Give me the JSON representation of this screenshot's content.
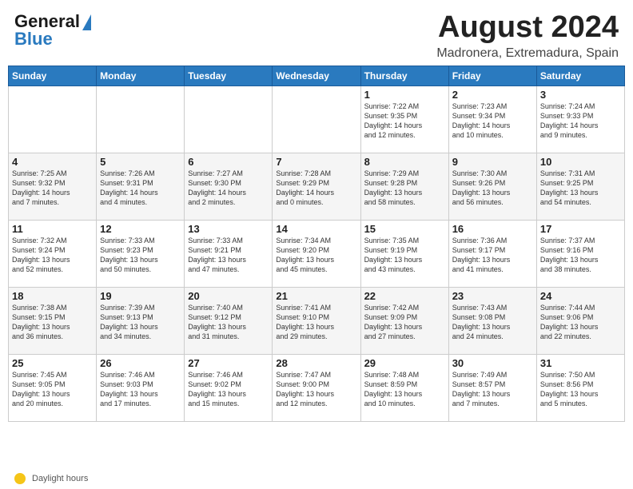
{
  "header": {
    "logo_line1": "General",
    "logo_line2": "Blue",
    "main_title": "August 2024",
    "subtitle": "Madronera, Extremadura, Spain"
  },
  "calendar": {
    "days_of_week": [
      "Sunday",
      "Monday",
      "Tuesday",
      "Wednesday",
      "Thursday",
      "Friday",
      "Saturday"
    ],
    "weeks": [
      [
        {
          "num": "",
          "info": ""
        },
        {
          "num": "",
          "info": ""
        },
        {
          "num": "",
          "info": ""
        },
        {
          "num": "",
          "info": ""
        },
        {
          "num": "1",
          "info": "Sunrise: 7:22 AM\nSunset: 9:35 PM\nDaylight: 14 hours\nand 12 minutes."
        },
        {
          "num": "2",
          "info": "Sunrise: 7:23 AM\nSunset: 9:34 PM\nDaylight: 14 hours\nand 10 minutes."
        },
        {
          "num": "3",
          "info": "Sunrise: 7:24 AM\nSunset: 9:33 PM\nDaylight: 14 hours\nand 9 minutes."
        }
      ],
      [
        {
          "num": "4",
          "info": "Sunrise: 7:25 AM\nSunset: 9:32 PM\nDaylight: 14 hours\nand 7 minutes."
        },
        {
          "num": "5",
          "info": "Sunrise: 7:26 AM\nSunset: 9:31 PM\nDaylight: 14 hours\nand 4 minutes."
        },
        {
          "num": "6",
          "info": "Sunrise: 7:27 AM\nSunset: 9:30 PM\nDaylight: 14 hours\nand 2 minutes."
        },
        {
          "num": "7",
          "info": "Sunrise: 7:28 AM\nSunset: 9:29 PM\nDaylight: 14 hours\nand 0 minutes."
        },
        {
          "num": "8",
          "info": "Sunrise: 7:29 AM\nSunset: 9:28 PM\nDaylight: 13 hours\nand 58 minutes."
        },
        {
          "num": "9",
          "info": "Sunrise: 7:30 AM\nSunset: 9:26 PM\nDaylight: 13 hours\nand 56 minutes."
        },
        {
          "num": "10",
          "info": "Sunrise: 7:31 AM\nSunset: 9:25 PM\nDaylight: 13 hours\nand 54 minutes."
        }
      ],
      [
        {
          "num": "11",
          "info": "Sunrise: 7:32 AM\nSunset: 9:24 PM\nDaylight: 13 hours\nand 52 minutes."
        },
        {
          "num": "12",
          "info": "Sunrise: 7:33 AM\nSunset: 9:23 PM\nDaylight: 13 hours\nand 50 minutes."
        },
        {
          "num": "13",
          "info": "Sunrise: 7:33 AM\nSunset: 9:21 PM\nDaylight: 13 hours\nand 47 minutes."
        },
        {
          "num": "14",
          "info": "Sunrise: 7:34 AM\nSunset: 9:20 PM\nDaylight: 13 hours\nand 45 minutes."
        },
        {
          "num": "15",
          "info": "Sunrise: 7:35 AM\nSunset: 9:19 PM\nDaylight: 13 hours\nand 43 minutes."
        },
        {
          "num": "16",
          "info": "Sunrise: 7:36 AM\nSunset: 9:17 PM\nDaylight: 13 hours\nand 41 minutes."
        },
        {
          "num": "17",
          "info": "Sunrise: 7:37 AM\nSunset: 9:16 PM\nDaylight: 13 hours\nand 38 minutes."
        }
      ],
      [
        {
          "num": "18",
          "info": "Sunrise: 7:38 AM\nSunset: 9:15 PM\nDaylight: 13 hours\nand 36 minutes."
        },
        {
          "num": "19",
          "info": "Sunrise: 7:39 AM\nSunset: 9:13 PM\nDaylight: 13 hours\nand 34 minutes."
        },
        {
          "num": "20",
          "info": "Sunrise: 7:40 AM\nSunset: 9:12 PM\nDaylight: 13 hours\nand 31 minutes."
        },
        {
          "num": "21",
          "info": "Sunrise: 7:41 AM\nSunset: 9:10 PM\nDaylight: 13 hours\nand 29 minutes."
        },
        {
          "num": "22",
          "info": "Sunrise: 7:42 AM\nSunset: 9:09 PM\nDaylight: 13 hours\nand 27 minutes."
        },
        {
          "num": "23",
          "info": "Sunrise: 7:43 AM\nSunset: 9:08 PM\nDaylight: 13 hours\nand 24 minutes."
        },
        {
          "num": "24",
          "info": "Sunrise: 7:44 AM\nSunset: 9:06 PM\nDaylight: 13 hours\nand 22 minutes."
        }
      ],
      [
        {
          "num": "25",
          "info": "Sunrise: 7:45 AM\nSunset: 9:05 PM\nDaylight: 13 hours\nand 20 minutes."
        },
        {
          "num": "26",
          "info": "Sunrise: 7:46 AM\nSunset: 9:03 PM\nDaylight: 13 hours\nand 17 minutes."
        },
        {
          "num": "27",
          "info": "Sunrise: 7:46 AM\nSunset: 9:02 PM\nDaylight: 13 hours\nand 15 minutes."
        },
        {
          "num": "28",
          "info": "Sunrise: 7:47 AM\nSunset: 9:00 PM\nDaylight: 13 hours\nand 12 minutes."
        },
        {
          "num": "29",
          "info": "Sunrise: 7:48 AM\nSunset: 8:59 PM\nDaylight: 13 hours\nand 10 minutes."
        },
        {
          "num": "30",
          "info": "Sunrise: 7:49 AM\nSunset: 8:57 PM\nDaylight: 13 hours\nand 7 minutes."
        },
        {
          "num": "31",
          "info": "Sunrise: 7:50 AM\nSunset: 8:56 PM\nDaylight: 13 hours\nand 5 minutes."
        }
      ]
    ]
  },
  "footer": {
    "daylight_label": "Daylight hours"
  }
}
